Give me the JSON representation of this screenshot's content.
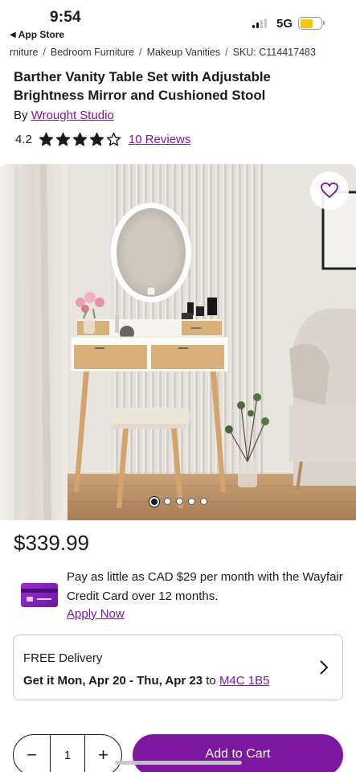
{
  "status_bar": {
    "time": "9:54",
    "back_label": "App Store",
    "network": "5G",
    "battery_level": 0.6
  },
  "breadcrumb": [
    "rniture",
    "Bedroom Furniture",
    "Makeup Vanities",
    "SKU: C114417483"
  ],
  "product": {
    "title": "Barther Vanity Table Set with Adjustable Brightness Mirror and Cushioned Stool",
    "by_prefix": "By",
    "brand": "Wrought Studio",
    "rating": "4.2",
    "stars_filled": 4,
    "stars_total": 5,
    "reviews_link": "10 Reviews",
    "price": "$339.99"
  },
  "gallery": {
    "total_images": 5,
    "active_index": 0
  },
  "credit": {
    "text": "Pay as little as CAD $29 per month with the Wayfair Credit Card over 12 months.",
    "apply_link": "Apply Now"
  },
  "delivery": {
    "title": "FREE Delivery",
    "dates": "Get it Mon, Apr 20 - Thu, Apr 23",
    "to": "to",
    "postal_code": "M4C 1B5"
  },
  "cart": {
    "quantity": "1",
    "minus": "−",
    "plus": "+",
    "add_label": "Add to Cart"
  },
  "colors": {
    "accent": "#7b189f"
  }
}
